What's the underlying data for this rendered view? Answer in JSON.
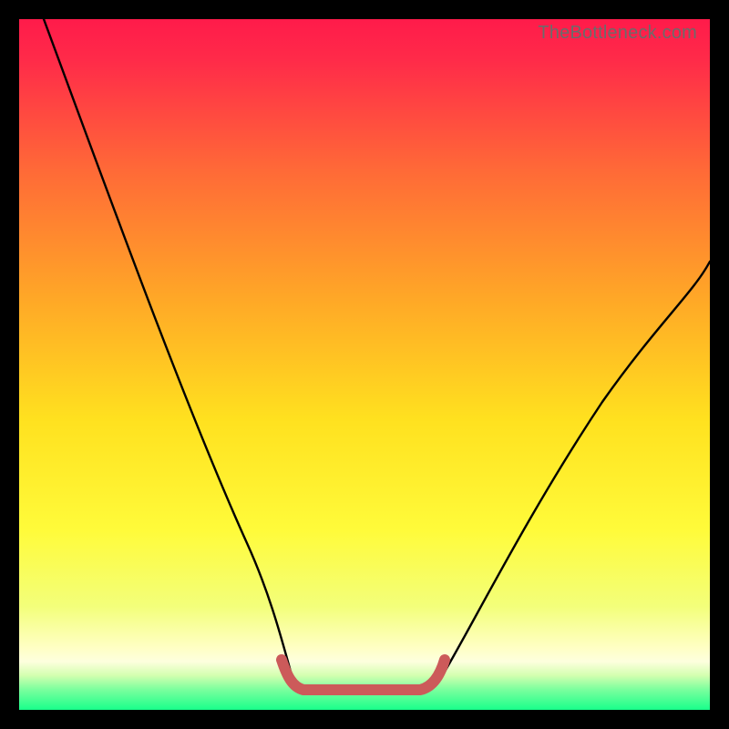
{
  "watermark": {
    "text": "TheBottleneck.com"
  },
  "chart_data": {
    "type": "line",
    "title": "",
    "xlabel": "",
    "ylabel": "",
    "xlim": [
      0,
      100
    ],
    "ylim": [
      0,
      100
    ],
    "series": [
      {
        "name": "bottleneck-curve-left",
        "x": [
          3.6,
          6.0,
          9.0,
          12.0,
          15.0,
          18.0,
          21.0,
          24.0,
          27.0,
          30.0,
          33.0,
          36.0,
          38.0,
          39.3,
          40.3,
          41.3,
          42.3
        ],
        "values": [
          100,
          94.0,
          86.5,
          79.0,
          71.5,
          64.0,
          56.5,
          49.0,
          41.5,
          34.0,
          26.0,
          15.0,
          5.6,
          3.6,
          3.2,
          3.0,
          2.9
        ]
      },
      {
        "name": "optimal-band",
        "x": [
          42.3,
          46.0,
          50.0,
          54.0,
          57.3
        ],
        "values": [
          2.9,
          2.7,
          2.6,
          2.7,
          2.9
        ]
      },
      {
        "name": "bottleneck-curve-right",
        "x": [
          57.3,
          59.0,
          61.6,
          65.0,
          70.0,
          75.0,
          80.0,
          85.0,
          90.0,
          95.0,
          100.0
        ],
        "values": [
          2.9,
          3.2,
          5.6,
          12.0,
          21.5,
          30.0,
          38.0,
          45.5,
          52.5,
          59.0,
          65.0
        ]
      }
    ],
    "notes": "Percentages read against a 0-100 scale in both axes (left/bottom = 0). Values estimated from pixel positions; chart has no visible ticks or labels."
  },
  "colors": {
    "gradient_top": "#ff1b4a",
    "gradient_mid_upper": "#ff7a33",
    "gradient_mid": "#ffe324",
    "gradient_low": "#f3ff7a",
    "gradient_band": "#ffffc4",
    "gradient_bottom": "#19ff8b",
    "curve": "#000000",
    "accent_segment": "#cc5a5a",
    "watermark": "#6b6b6b"
  }
}
